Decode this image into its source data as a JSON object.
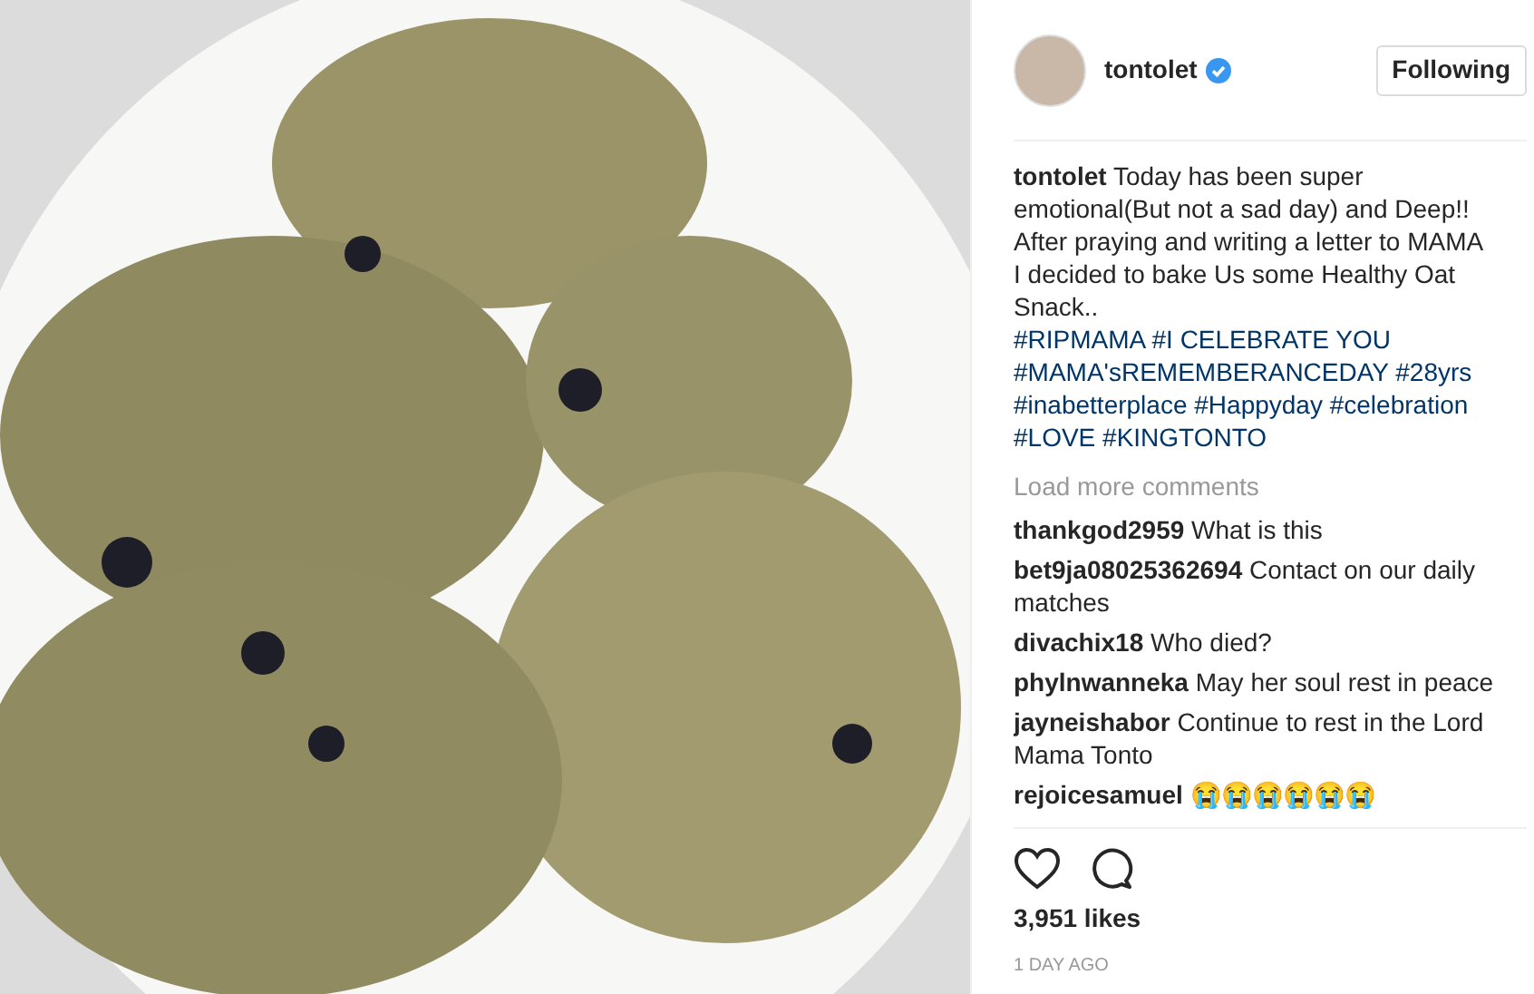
{
  "post": {
    "author": {
      "username": "tontolet",
      "verified": true
    },
    "follow_button": {
      "label": "Following"
    },
    "caption": {
      "username": "tontolet",
      "text": "Today has been super emotional(But not a sad day) and Deep!! After praying and writing a letter to MAMA I decided to bake Us some Healthy Oat Snack..",
      "hashtags": [
        "#RIPMAMA",
        "#I CELEBRATE YOU",
        "#MAMA'sREMEMBERANCEDAY",
        "#28yrs",
        "#inabetterplace",
        "#Happyday",
        "#celebration",
        "#LOVE",
        "#KINGTONTO"
      ]
    },
    "load_more": "Load more comments",
    "comments": [
      {
        "username": "thankgod2959",
        "text": "What is this"
      },
      {
        "username": "bet9ja08025362694",
        "text": "Contact on our daily matches"
      },
      {
        "username": "divachix18",
        "text": "Who died?"
      },
      {
        "username": "phylnwanneka",
        "text": "May her soul rest in peace"
      },
      {
        "username": "jayneishabor",
        "text": "Continue to rest in the Lord Mama Tonto"
      },
      {
        "username": "rejoicesamuel",
        "text": "😭😭😭😭😭😭"
      }
    ],
    "likes": "3,951 likes",
    "time": "1 DAY AGO"
  }
}
